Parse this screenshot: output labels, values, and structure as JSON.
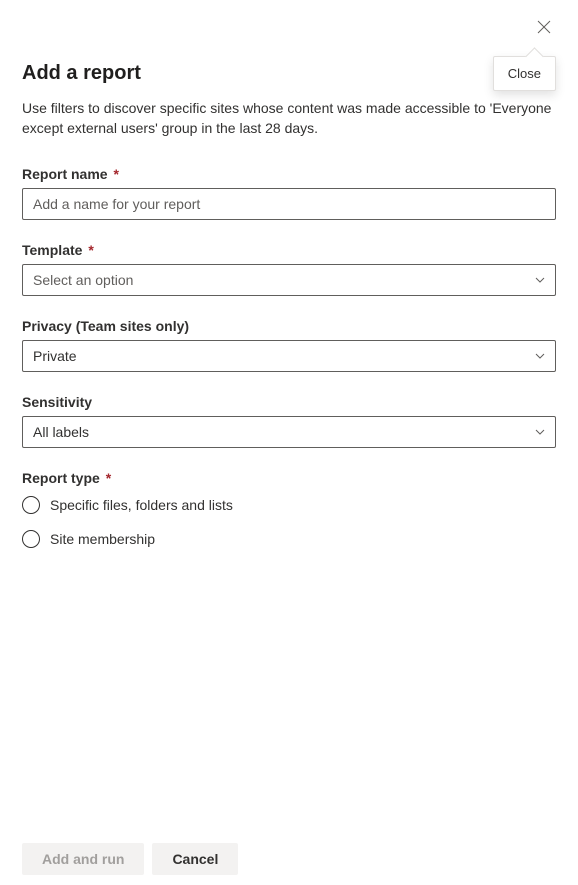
{
  "header": {
    "title": "Add a report",
    "close_tooltip": "Close",
    "description": "Use filters to discover specific sites whose content was made accessible to 'Everyone except external users' group in the last 28 days."
  },
  "fields": {
    "report_name": {
      "label": "Report name",
      "required": true,
      "placeholder": "Add a name for your report",
      "value": ""
    },
    "template": {
      "label": "Template",
      "required": true,
      "placeholder": "Select an option",
      "value": ""
    },
    "privacy": {
      "label": "Privacy (Team sites only)",
      "required": false,
      "value": "Private"
    },
    "sensitivity": {
      "label": "Sensitivity",
      "required": false,
      "value": "All labels"
    },
    "report_type": {
      "label": "Report type",
      "required": true,
      "options": [
        "Specific files, folders and lists",
        "Site membership"
      ],
      "selected": null
    }
  },
  "footer": {
    "primary": "Add and run",
    "secondary": "Cancel"
  },
  "asterisk": "*"
}
